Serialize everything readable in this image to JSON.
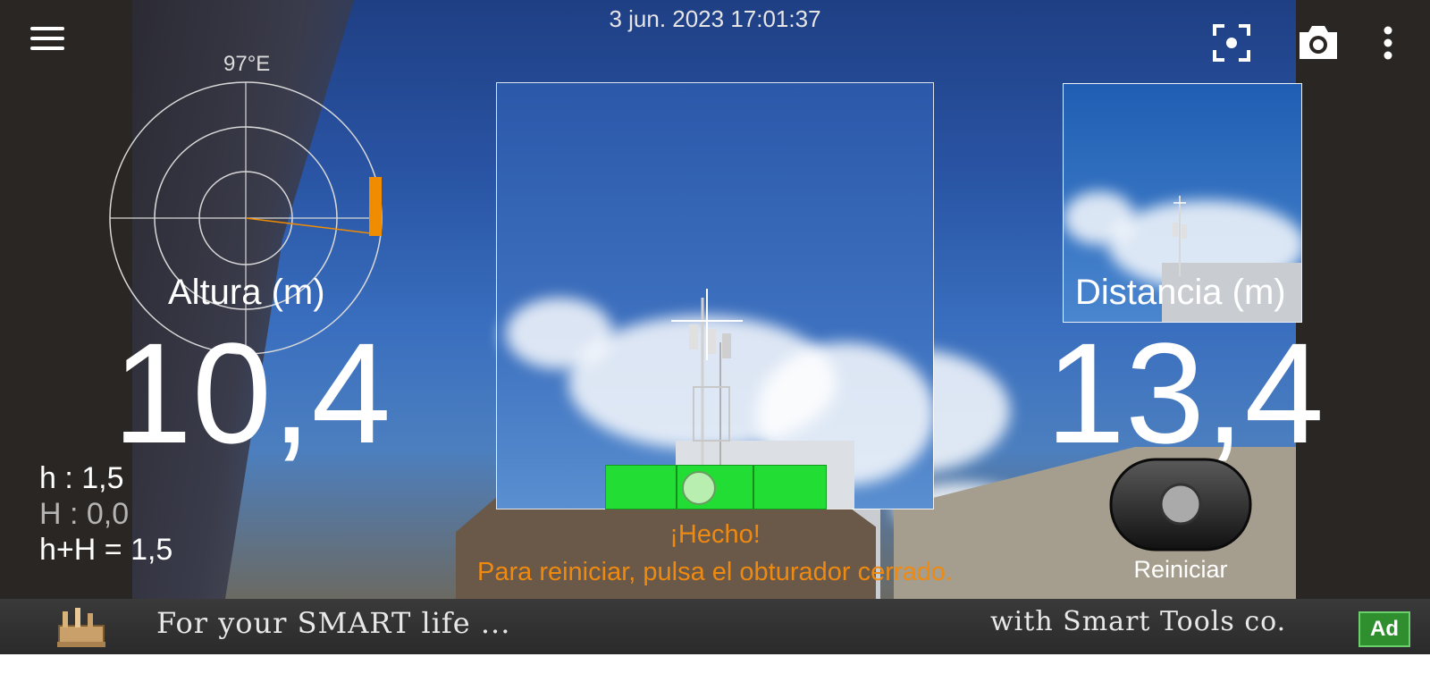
{
  "timestamp": "3 jun. 2023 17:01:37",
  "compass": {
    "heading": "97°E"
  },
  "height": {
    "label": "Altura (m)",
    "value": "10,4"
  },
  "distance": {
    "label": "Distancia (m)",
    "value": "13,4"
  },
  "heights_info": {
    "h": "h : 1,5",
    "H": "H : 0,0",
    "sum": "h+H = 1,5"
  },
  "status": {
    "done": "¡Hecho!",
    "instruction": "Para reiniciar, pulsa el obturador cerrado."
  },
  "shutter": {
    "label": "Reiniciar"
  },
  "ad": {
    "left_text": "For your SMART life ...",
    "right_text": "with Smart Tools co.",
    "badge": "Ad"
  },
  "colors": {
    "status_orange": "#ef8a10",
    "level_green": "#22dd33",
    "marker_orange": "#f08c00"
  },
  "icons": [
    "menu-icon",
    "focus-icon",
    "camera-icon",
    "more-vert-icon",
    "toolbox-icon"
  ]
}
